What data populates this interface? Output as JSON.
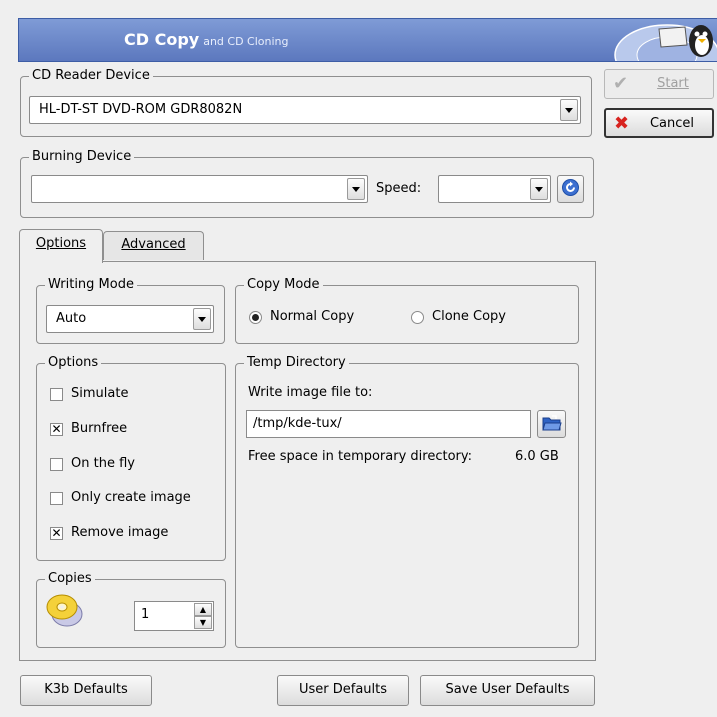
{
  "header": {
    "title": "CD Copy",
    "subtitle": "and CD Cloning"
  },
  "reader": {
    "legend": "CD Reader Device",
    "device": "HL-DT-ST DVD-ROM GDR8082N"
  },
  "side_buttons": {
    "start": "Start",
    "cancel": "Cancel"
  },
  "burner": {
    "legend": "Burning Device",
    "device": "",
    "speed_label": "Speed:",
    "speed_value": ""
  },
  "tabs": [
    {
      "label": "Options"
    },
    {
      "label": "Advanced"
    }
  ],
  "writing_mode": {
    "legend": "Writing Mode",
    "value": "Auto"
  },
  "copy_mode": {
    "legend": "Copy Mode",
    "normal": "Normal Copy",
    "clone": "Clone Copy",
    "selected": "normal"
  },
  "options": {
    "legend": "Options",
    "items": [
      {
        "label": "Simulate",
        "checked": false
      },
      {
        "label": "Burnfree",
        "checked": true
      },
      {
        "label": "On the fly",
        "checked": false
      },
      {
        "label": "Only create image",
        "checked": false
      },
      {
        "label": "Remove image",
        "checked": true
      }
    ]
  },
  "copies": {
    "legend": "Copies",
    "value": "1"
  },
  "temp": {
    "legend": "Temp Directory",
    "write_label": "Write image file to:",
    "path": "/tmp/kde-tux/",
    "free_space_label": "Free space in temporary directory:",
    "free_space_value": "6.0 GB"
  },
  "footer": {
    "k3b_defaults": "K3b Defaults",
    "user_defaults": "User Defaults",
    "save_user_defaults": "Save User Defaults"
  },
  "colors": {
    "banner": "#6a86c8",
    "cancel_icon": "#d8231f",
    "accent": "#3c6fd0"
  }
}
